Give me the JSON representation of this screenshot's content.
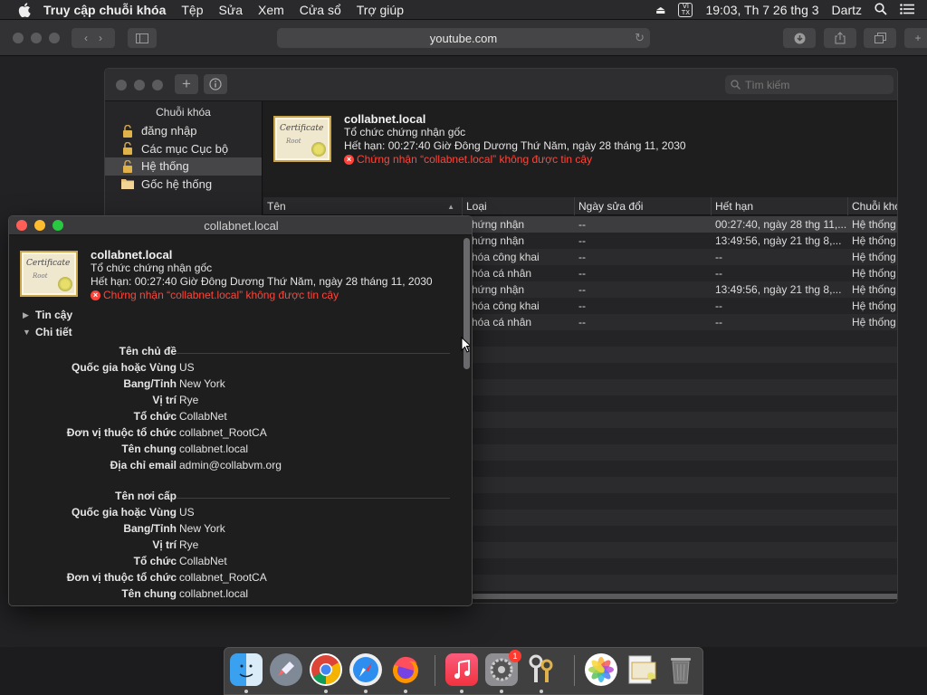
{
  "menubar": {
    "app_name": "Truy cập chuỗi khóa",
    "items": [
      "Tệp",
      "Sửa",
      "Xem",
      "Cửa sổ",
      "Trợ giúp"
    ],
    "input_source": "VI\nTX",
    "clock": "19:03, Th 7 26 thg 3",
    "user": "Dartz"
  },
  "safari": {
    "url": "youtube.com"
  },
  "keychain": {
    "search_placeholder": "Tìm kiếm",
    "sidebar": {
      "header": "Chuỗi khóa",
      "items": [
        "đăng nhập",
        "Các mục Cục bộ",
        "Hệ thống",
        "Gốc hệ thống"
      ],
      "selected_index": 2
    },
    "info": {
      "name": "collabnet.local",
      "type": "Tổ chức chứng nhận gốc",
      "expires": "Hết hạn: 00:27:40 Giờ Đông Dương Thứ Năm, ngày 28 tháng 11, 2030",
      "error": "Chứng nhận “collabnet.local” không được tin cậy"
    },
    "table": {
      "columns": [
        "Tên",
        "Loại",
        "Ngày sửa đổi",
        "Hết hạn",
        "Chuỗi khóa"
      ],
      "rows": [
        [
          "",
          "chứng nhận",
          "--",
          "00:27:40, ngày 28 thg 11,...",
          "Hệ thống"
        ],
        [
          "",
          "chứng nhận",
          "--",
          "13:49:56, ngày 21 thg 8,...",
          "Hệ thống"
        ],
        [
          "",
          "khóa công khai",
          "--",
          "--",
          "Hệ thống"
        ],
        [
          "",
          "khóa cá nhân",
          "--",
          "--",
          "Hệ thống"
        ],
        [
          "",
          "chứng nhận",
          "--",
          "13:49:56, ngày 21 thg 8,...",
          "Hệ thống"
        ],
        [
          "",
          "khóa công khai",
          "--",
          "--",
          "Hệ thống"
        ],
        [
          "",
          "khóa cá nhân",
          "--",
          "--",
          "Hệ thống"
        ]
      ]
    }
  },
  "certwin": {
    "title": "collabnet.local",
    "name": "collabnet.local",
    "type": "Tổ chức chứng nhận gốc",
    "expires": "Hết hạn: 00:27:40 Giờ Đông Dương Thứ Năm, ngày 28 tháng 11, 2030",
    "error": "Chứng nhận “collabnet.local” không được tin cậy",
    "trust_label": "Tin cậy",
    "details_label": "Chi tiết",
    "subject": {
      "header": "Tên chủ đề",
      "fields": [
        {
          "label": "Quốc gia hoặc Vùng",
          "value": "US"
        },
        {
          "label": "Bang/Tỉnh",
          "value": "New York"
        },
        {
          "label": "Vị trí",
          "value": "Rye"
        },
        {
          "label": "Tổ chức",
          "value": "CollabNet"
        },
        {
          "label": "Đơn vị thuộc tổ chức",
          "value": "collabnet_RootCA"
        },
        {
          "label": "Tên chung",
          "value": "collabnet.local"
        },
        {
          "label": "Địa chỉ email",
          "value": "admin@collabvm.org"
        }
      ]
    },
    "issuer": {
      "header": "Tên nơi cấp",
      "fields": [
        {
          "label": "Quốc gia hoặc Vùng",
          "value": "US"
        },
        {
          "label": "Bang/Tỉnh",
          "value": "New York"
        },
        {
          "label": "Vị trí",
          "value": "Rye"
        },
        {
          "label": "Tổ chức",
          "value": "CollabNet"
        },
        {
          "label": "Đơn vị thuộc tổ chức",
          "value": "collabnet_RootCA"
        },
        {
          "label": "Tên chung",
          "value": "collabnet.local"
        },
        {
          "label": "Địa chỉ email",
          "value": "admin@collabvm.org"
        }
      ]
    }
  },
  "cert_image": {
    "line1": "Certificate",
    "line2": "Root"
  },
  "dock": {
    "apps": [
      "finder-icon",
      "launchpad-icon",
      "chrome-icon",
      "safari-icon",
      "firefox-icon",
      "music-icon",
      "system-preferences-icon",
      "keychain-access-icon",
      "photos-icon",
      "certificate-file-icon",
      "trash-icon"
    ],
    "system_preferences_badge": "1"
  },
  "colors": {
    "error": "#ff453a",
    "selection": "#464648"
  }
}
